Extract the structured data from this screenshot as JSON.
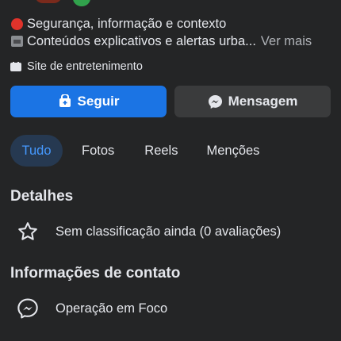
{
  "bio": {
    "line1_icon": "red-circle-icon",
    "line1_text": "Segurança, informação e contexto",
    "line2_icon": "clapper-board-icon",
    "line2_text": "Conteúdos explicativos e alertas urba...",
    "see_more": "Ver mais"
  },
  "category": {
    "icon": "page-category-icon",
    "label": "Site de entretenimento"
  },
  "actions": {
    "follow_icon": "follow-icon",
    "follow_label": "Seguir",
    "message_icon": "messenger-icon",
    "message_label": "Mensagem"
  },
  "tabs": [
    {
      "label": "Tudo",
      "active": true
    },
    {
      "label": "Fotos",
      "active": false
    },
    {
      "label": "Reels",
      "active": false
    },
    {
      "label": "Menções",
      "active": false
    }
  ],
  "details": {
    "title": "Detalhes",
    "rating_icon": "star-icon",
    "rating_text": "Sem classificação ainda (0 avaliações)"
  },
  "contact": {
    "title": "Informações de contato",
    "messenger_icon": "messenger-icon",
    "messenger_text": "Operação em Foco"
  },
  "colors": {
    "background": "#242526",
    "primary_button": "#1b74e4",
    "secondary_button": "#3a3b3c",
    "active_tab_bg": "#263951",
    "active_tab_text": "#4599ff",
    "text": "#e4e6eb",
    "muted_text": "#b0b3b8"
  }
}
